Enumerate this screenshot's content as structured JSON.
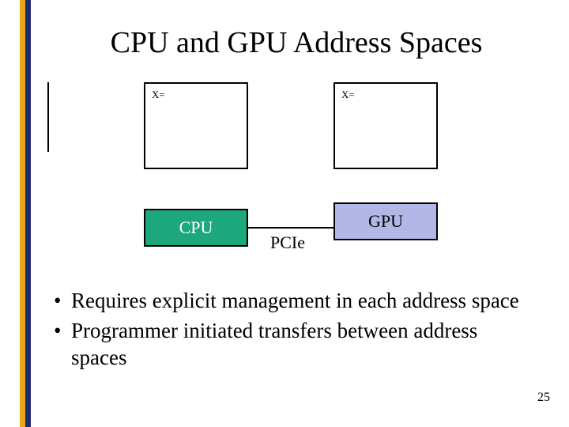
{
  "title": "CPU and GPU Address Spaces",
  "diagram": {
    "memory_cpu_label": "X=",
    "memory_gpu_label": "X=",
    "cpu_label": "CPU",
    "gpu_label": "GPU",
    "interconnect_label": "PCIe"
  },
  "bullets": [
    "Requires explicit management in each address space",
    "Programmer initiated transfers between address spaces"
  ],
  "page_number": "25",
  "colors": {
    "gold": "#e6a817",
    "navy": "#1e2a6e",
    "cpu_fill": "#1da77c",
    "gpu_fill": "#b3b7e6"
  }
}
